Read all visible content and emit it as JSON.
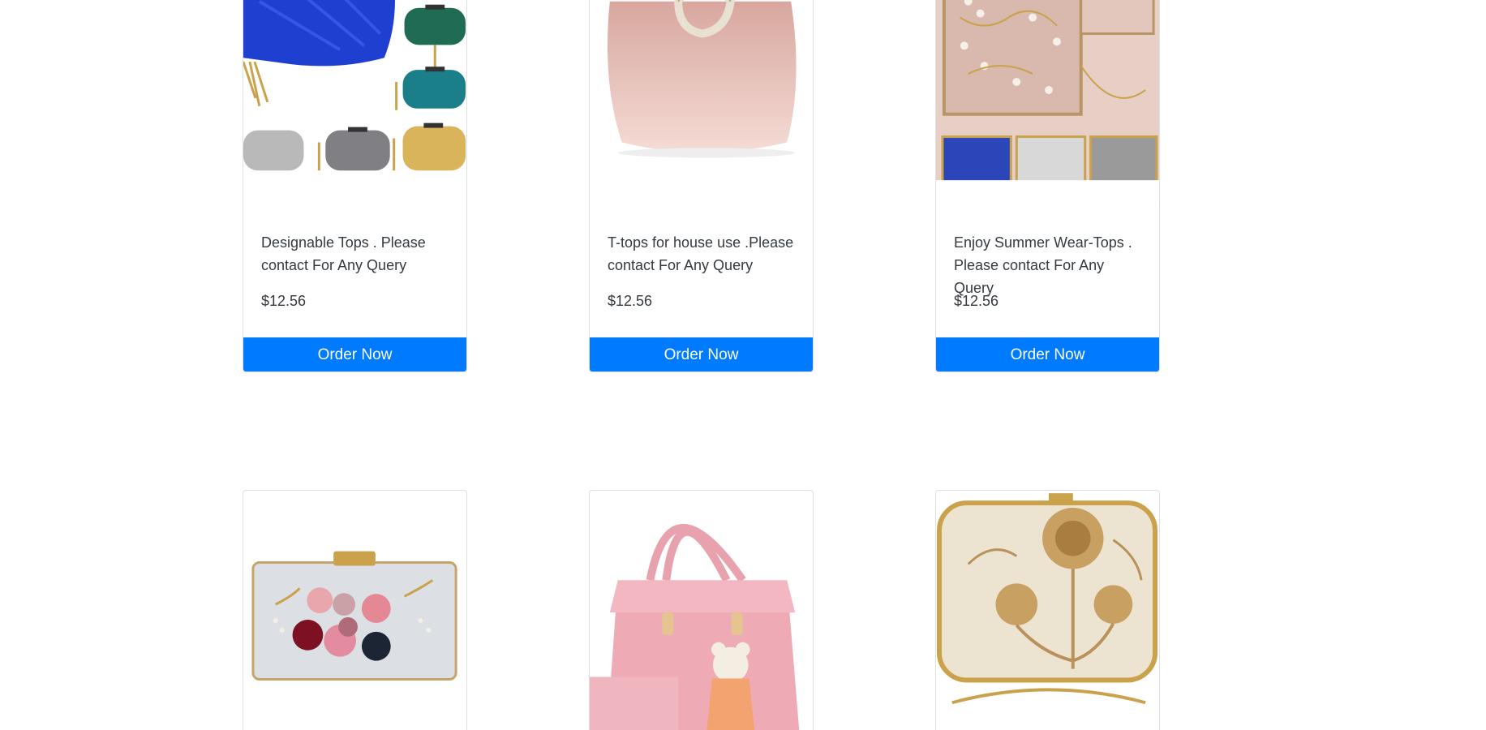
{
  "products_top": [
    {
      "description": "Designable Tops . Please contact For Any Query",
      "price": "$12.56",
      "button_label": "Order Now",
      "image": "blue-satin-clutch-set-image"
    },
    {
      "description": "T-tops for house use .Please contact For Any Query",
      "price": "$12.56",
      "button_label": "Order Now",
      "image": "pink-glitter-handbag-image"
    },
    {
      "description": "Enjoy Summer Wear-Tops . Please contact For Any Query",
      "price": "$12.56",
      "button_label": "Order Now",
      "image": "pearl-clutch-set-image"
    }
  ],
  "products_bottom": [
    {
      "image": "flower-clutch-image"
    },
    {
      "image": "pink-handbag-teddy-image"
    },
    {
      "image": "embroidered-gold-clutch-image"
    }
  ],
  "colors": {
    "button": "#007bff",
    "button_text": "#ffffff",
    "card_border": "#dfdfdf"
  }
}
